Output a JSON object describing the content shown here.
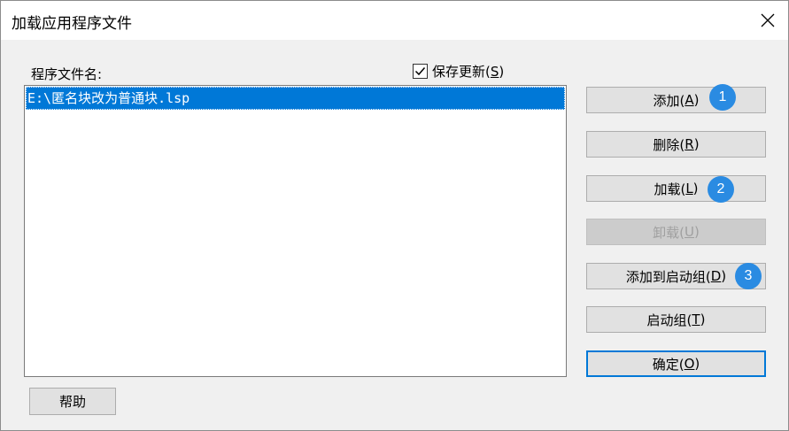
{
  "window": {
    "title": "加载应用程序文件"
  },
  "files_label": "程序文件名:",
  "save_updates": {
    "label_prefix": "保存更新(",
    "hotkey": "S",
    "label_suffix": ")",
    "checked": true
  },
  "file_list": [
    "E:\\匿名块改为普通块.lsp"
  ],
  "buttons": {
    "add": {
      "prefix": "添加(",
      "hotkey": "A",
      "suffix": ")"
    },
    "remove": {
      "prefix": "删除(",
      "hotkey": "R",
      "suffix": ")"
    },
    "load": {
      "prefix": "加载(",
      "hotkey": "L",
      "suffix": ")"
    },
    "unload": {
      "prefix": "卸载(",
      "hotkey": "U",
      "suffix": ")"
    },
    "add_to_startup": {
      "prefix": "添加到启动组(",
      "hotkey": "D",
      "suffix": ")"
    },
    "startup_group": {
      "prefix": "启动组(",
      "hotkey": "T",
      "suffix": ")"
    },
    "ok": {
      "prefix": "确定(",
      "hotkey": "O",
      "suffix": ")"
    },
    "help": "帮助"
  },
  "step_badges": [
    "1",
    "2",
    "3"
  ],
  "colors": {
    "selection": "#0078d7",
    "badge": "#2a8be2"
  }
}
